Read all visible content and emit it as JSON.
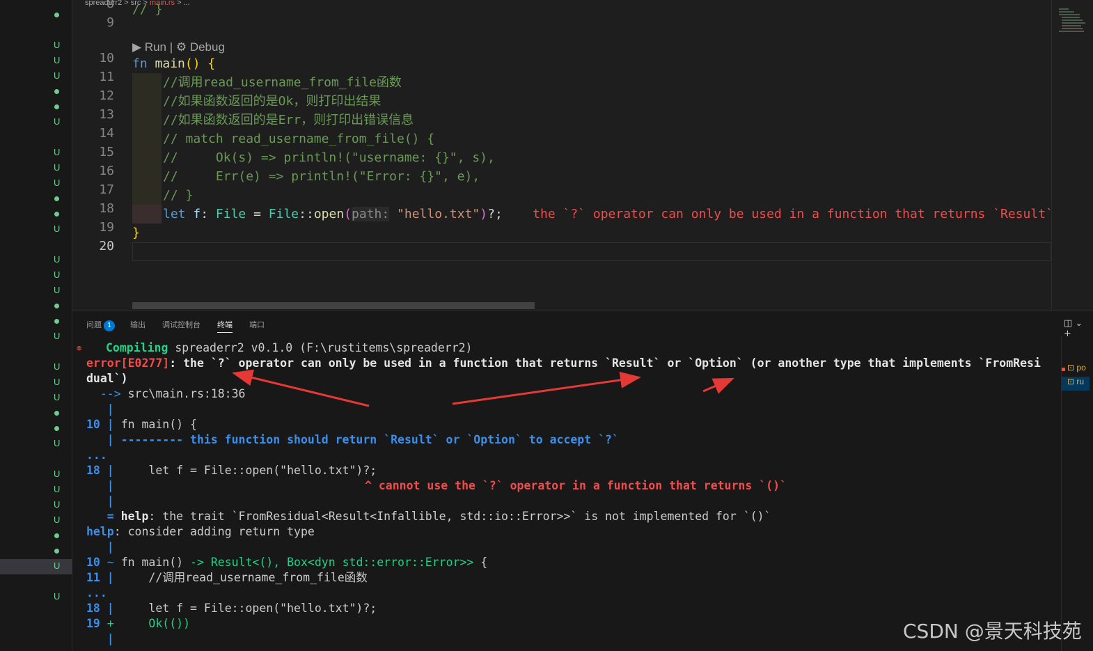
{
  "breadcrumb": {
    "project": "spreaderr2",
    "sep1": " > ",
    "folder": "src",
    "sep2": " > ",
    "file": "main.rs",
    "sep3": " > ..."
  },
  "explorer": {
    "rows": [
      {
        "mark": "dot"
      },
      {
        "mark": ""
      },
      {
        "mark": "U"
      },
      {
        "mark": "U"
      },
      {
        "mark": "U"
      },
      {
        "mark": "dot"
      },
      {
        "mark": "dot"
      },
      {
        "mark": "U"
      },
      {
        "mark": ""
      },
      {
        "mark": "U"
      },
      {
        "mark": "U"
      },
      {
        "mark": "U"
      },
      {
        "mark": "dot"
      },
      {
        "mark": "dot"
      },
      {
        "mark": "U"
      },
      {
        "mark": ""
      },
      {
        "mark": "U"
      },
      {
        "mark": "U"
      },
      {
        "mark": "U"
      },
      {
        "mark": "dot"
      },
      {
        "mark": "dot"
      },
      {
        "mark": "U"
      },
      {
        "mark": ""
      },
      {
        "mark": "U"
      },
      {
        "mark": "U"
      },
      {
        "mark": "U"
      },
      {
        "mark": "dot"
      },
      {
        "mark": "dot"
      },
      {
        "mark": "U"
      },
      {
        "mark": ""
      },
      {
        "mark": "U"
      },
      {
        "mark": "U"
      },
      {
        "mark": "U"
      },
      {
        "mark": "U"
      },
      {
        "mark": "dot"
      },
      {
        "mark": "dot"
      },
      {
        "mark": "U"
      },
      {
        "mark": ""
      },
      {
        "mark": "U"
      }
    ]
  },
  "editor": {
    "line_numbers": [
      "8",
      "9",
      "10",
      "11",
      "12",
      "13",
      "14",
      "15",
      "16",
      "17",
      "18",
      "19",
      "20"
    ],
    "codelens": {
      "run": "▶ Run",
      "sep": " | ",
      "debug": "⚙ Debug"
    },
    "line8": "// }",
    "line10": {
      "fn": "fn",
      "name": "main",
      "parens": "()",
      "brace": "{"
    },
    "line11": "//调用read_username_from_file函数",
    "line12": "//如果函数返回的是Ok，则打印出结果",
    "line13": "//如果函数返回的是Err，则打印出错误信息",
    "line14": "// match read_username_from_file() {",
    "line15": "//     Ok(s) => println!(\"username: {}\", s),",
    "line16": "//     Err(e) => println!(\"Error: {}\", e),",
    "line17": "// }",
    "line18": {
      "let": "let",
      "var": "f",
      "colon": ":",
      "type": "File",
      "eq": " = ",
      "type2": "File",
      "path": "::",
      "fn": "open",
      "open": "(",
      "hint": "path:",
      "str": "\"hello.txt\"",
      "close": ")",
      "tail": "?;",
      "error": "the `?` operator can only be used in a function that returns `Result`"
    },
    "line19": "}"
  },
  "panel": {
    "tabs": {
      "problems": "问题",
      "problems_count": "1",
      "output": "输出",
      "debug_console": "调试控制台",
      "terminal": "终端",
      "ports": "端口"
    },
    "actions": "◫ ⌄ +"
  },
  "terminal": {
    "l1_compiling": "Compiling",
    "l1_rest": " spreaderr2 v0.1.0 (F:\\rustitems\\spreaderr2)",
    "l2_code": "error[E0277]",
    "l2_msg": ": the `?` operator can only be used in a function that returns `Result` or `Option` (or another type that implements `FromResi",
    "l3": "dual`)",
    "l4_arrow": "  --> ",
    "l4_loc": "src\\main.rs:18:36",
    "l5": "   |",
    "l6_num": "10",
    "l6_pipe": " | ",
    "l6_code": "fn main() {",
    "l7_pipe": "   | ",
    "l7_msg": "--------- this function should return `Result` or `Option` to accept `?`",
    "l8": "...",
    "l9_num": "18",
    "l9_pipe": " |     ",
    "l9_code": "let f = File::open(\"hello.txt\")?;",
    "l10_pipe": "   |",
    "l10_msg": "^ cannot use the `?` operator in a function that returns `()`",
    "l11": "   |",
    "l12_eq": "   = ",
    "l12_help": "help",
    "l12_msg": ": the trait `FromResidual<Result<Infallible, std::io::Error>>` is not implemented for `()`",
    "l13_help": "help",
    "l13_msg": ": consider adding return type",
    "l14": "   |",
    "l15_num": "10",
    "l15_tilde": " ~ ",
    "l15_code": "fn main() ",
    "l15_add": "-> Result<(), Box<dyn std::error::Error>>",
    "l15_tail": " {",
    "l16_num": "11",
    "l16_pipe": " |     ",
    "l16_code": "//调用read_username_from_file函数",
    "l17": "...",
    "l18_num": "18",
    "l18_pipe": " |     ",
    "l18_code": "let f = File::open(\"hello.txt\")?;",
    "l19_num": "19",
    "l19_plus": " +     ",
    "l19_code": "Ok(())",
    "l20": "   |"
  },
  "terminal_list": {
    "item1": "po",
    "item2": "ru"
  },
  "watermark": "CSDN @景天科技苑",
  "colors": {
    "error": "#f14c4c",
    "success": "#23d18b",
    "info": "#3b8eea",
    "annotation_arrow": "#e53935"
  }
}
